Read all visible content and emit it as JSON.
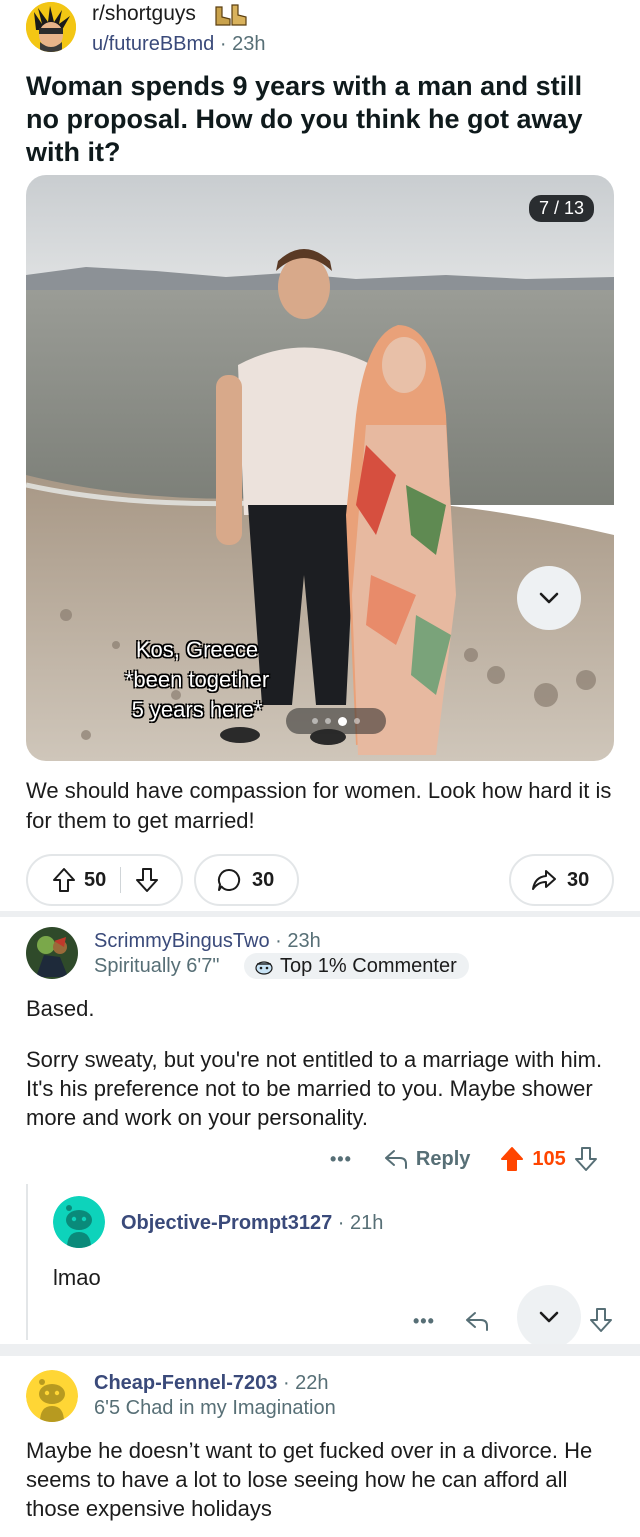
{
  "post": {
    "subreddit": "r/shortguys",
    "author": "u/futureBBmd",
    "time_sep": " · ",
    "time": "23h",
    "title": "Woman spends 9 years with a man and still no proposal. How do you think he got away with it?",
    "image_counter": "7 / 13",
    "image_caption_lines": [
      "Kos, Greece",
      "*been together",
      "5 years here*"
    ],
    "body": "We should have compassion for women. Look how hard it is for them to get married!",
    "upvotes": "50",
    "comments": "30",
    "shares": "30",
    "gallery": {
      "dot_count": 4,
      "active_dot": 2
    }
  },
  "comments": [
    {
      "user": "ScrimmyBingusTwo",
      "time": "23h",
      "flair": "Spiritually 6'7\"",
      "badge": "Top 1% Commenter",
      "paragraphs": [
        "Based.",
        "Sorry sweaty, but you're not entitled to a marriage with him. It's his preference not to be married to you. Maybe shower more and work on your personality."
      ],
      "more": "•••",
      "reply_label": "Reply",
      "score": "105"
    },
    {
      "user": "Objective-Prompt3127",
      "time": "21h",
      "text": "lmao",
      "more": "•••"
    },
    {
      "user": "Cheap-Fennel-7203",
      "time": "22h",
      "flair": "6'5 Chad in my Imagination",
      "text": "Maybe he doesn’t want to get fucked over in a divorce. He seems to have a lot to lose seeing how he can afford all those expensive holidays"
    }
  ],
  "colors": {
    "upvote_active": "#ff4500",
    "link_user": "#3a4a7a",
    "meta_gray": "#576f76",
    "pill_border": "#e3e6e8",
    "avatar_teal": "#0dd3bb",
    "avatar_yellow": "#ffd635"
  },
  "icons": {
    "upvote": "arrow-up-outline",
    "downvote": "arrow-down-outline",
    "comment": "speech-bubble",
    "share": "share-arrow",
    "reply": "reply-arrow",
    "collapse": "chevron-down"
  }
}
